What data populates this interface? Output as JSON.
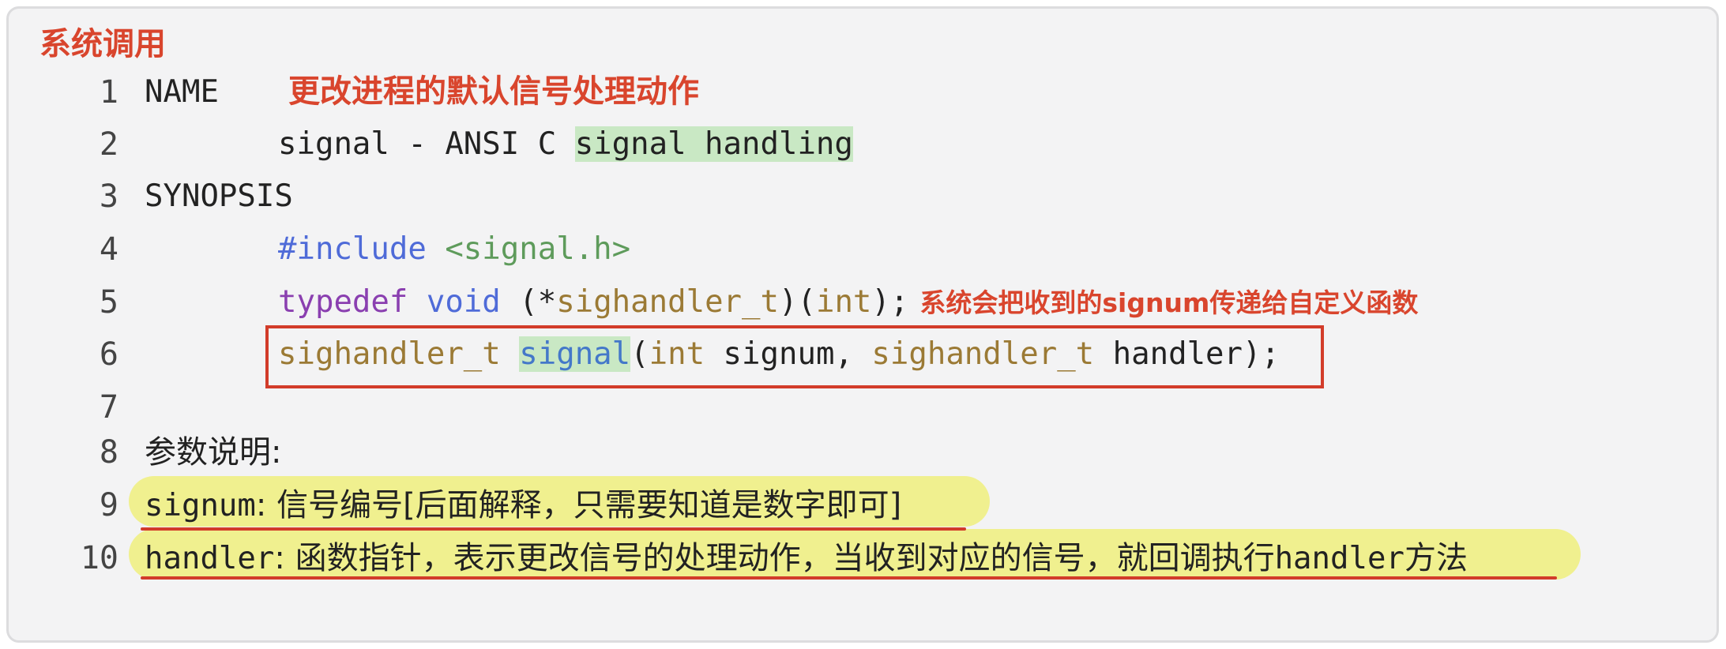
{
  "title": "系统调用",
  "annotations": {
    "name_note": "更改进程的默认信号处理动作",
    "typedef_note": "系统会把收到的signum传递给自定义函数"
  },
  "line_numbers": [
    "1",
    "2",
    "3",
    "4",
    "5",
    "6",
    "7",
    "8",
    "9",
    "10"
  ],
  "code": {
    "l1": "NAME",
    "l2_a": "signal - ANSI C ",
    "l2_b": "signal handling",
    "l3": "SYNOPSIS",
    "l4_kw": "#include",
    "l4_sp": " ",
    "l4_hdr": "<signal.h>",
    "l5_kw": "typedef",
    "l5_sp1": " ",
    "l5_ty": "void",
    "l5_a": " (*",
    "l5_tn": "sighandler_t",
    "l5_b": ")(",
    "l5_int": "int",
    "l5_c": ");",
    "l6_tn": "sighandler_t",
    "l6_sp": " ",
    "l6_fn": "signal",
    "l6_a": "(",
    "l6_int": "int",
    "l6_b": " signum, ",
    "l6_tn2": "sighandler_t",
    "l6_c": " handler);",
    "l8": "参数说明:",
    "l9_code": "signum",
    "l9_text": ": 信号编号[后面解释，只需要知道是数字即可]",
    "l10_code": "handler",
    "l10_text": ": 函数指针，表示更改信号的处理动作，当收到对应的信号，就回调执行",
    "l10_code2": "handler",
    "l10_text2": "方法"
  },
  "colors": {
    "annotation_red": "#d9452d",
    "keyword_purple": "#8a3fb0",
    "type_blue": "#4f6bd8",
    "string_green": "#5e9b5b",
    "typename_gold": "#9b7a35",
    "highlight_green": "#c9e8c4",
    "highlight_yellow": "#f0f08f"
  }
}
